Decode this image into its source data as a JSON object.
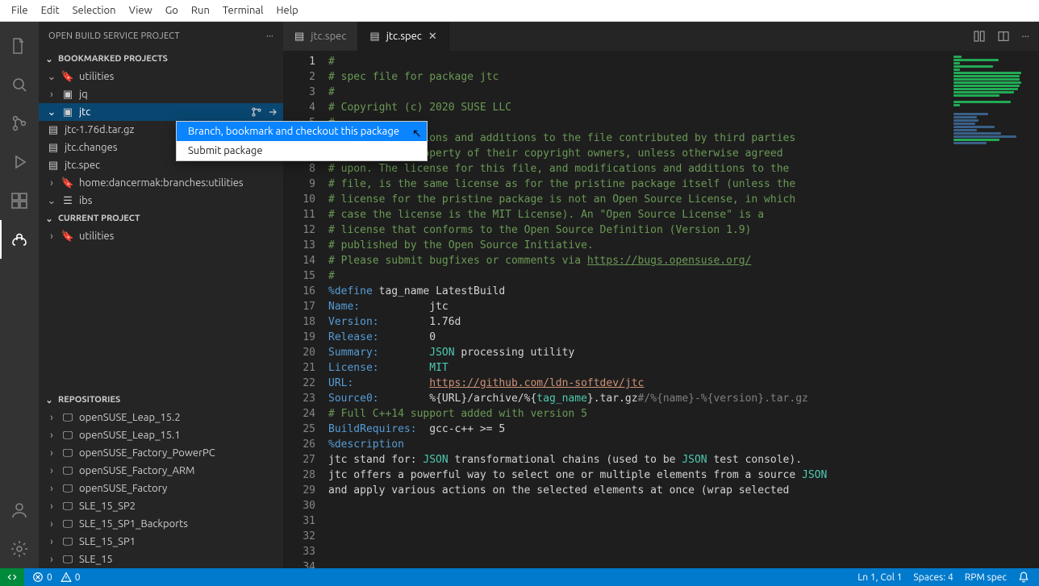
{
  "menubar": [
    "File",
    "Edit",
    "Selection",
    "View",
    "Go",
    "Run",
    "Terminal",
    "Help"
  ],
  "sidebar": {
    "title": "OPEN BUILD SERVICE PROJECT",
    "sections": {
      "bookmarked": "BOOKMARKED PROJECTS",
      "current": "CURRENT PROJECT",
      "repositories": "REPOSITORIES"
    },
    "tree1": {
      "utilities": "utilities",
      "jq": "jq",
      "jtc": "jtc",
      "jtc_files": [
        "jtc-1.76d.tar.gz",
        "jtc.changes",
        "jtc.spec"
      ],
      "home": "home:dancermak:branches:utilities",
      "ibs": "ibs"
    },
    "current_project_item": "utilities",
    "repositories": [
      "openSUSE_Leap_15.2",
      "openSUSE_Leap_15.1",
      "openSUSE_Factory_PowerPC",
      "openSUSE_Factory_ARM",
      "openSUSE_Factory",
      "SLE_15_SP2",
      "SLE_15_SP1_Backports",
      "SLE_15_SP1",
      "SLE_15"
    ]
  },
  "tabs": [
    {
      "label": "jtc.spec",
      "active": false
    },
    {
      "label": "jtc.spec",
      "active": true
    }
  ],
  "contextmenu": {
    "items": [
      "Branch, bookmark and checkout this package",
      "Submit package"
    ],
    "hovered": 0
  },
  "code": {
    "start_line": 1,
    "lines": [
      {
        "t": "c",
        "s": "#"
      },
      {
        "t": "c",
        "s": "# spec file for package jtc"
      },
      {
        "t": "c",
        "s": "#"
      },
      {
        "t": "c",
        "s": "# Copyright (c) 2020 SUSE LLC"
      },
      {
        "t": "c",
        "s": "#"
      },
      {
        "t": "c",
        "s": "# All modifications and additions to the file contributed by third parties"
      },
      {
        "t": "c",
        "s": "# remain the property of their copyright owners, unless otherwise agreed"
      },
      {
        "t": "c",
        "s": "# upon. The license for this file, and modifications and additions to the"
      },
      {
        "t": "c",
        "s": "# file, is the same license as for the pristine package itself (unless the"
      },
      {
        "t": "c",
        "s": "# license for the pristine package is not an Open Source License, in which"
      },
      {
        "t": "c",
        "s": "# case the license is the MIT License). An \"Open Source License\" is a"
      },
      {
        "t": "c",
        "s": "# license that conforms to the Open Source Definition (Version 1.9)"
      },
      {
        "t": "c",
        "s": "# published by the Open Source Initiative."
      },
      {
        "t": "e",
        "s": ""
      },
      {
        "t": "cx",
        "s": "# Please submit bugfixes or comments via ",
        "link": "https://bugs.opensuse.org/"
      },
      {
        "t": "c",
        "s": "#"
      },
      {
        "t": "e",
        "s": ""
      },
      {
        "t": "e",
        "s": ""
      },
      {
        "t": "def",
        "s": "%define tag_name LatestBuild"
      },
      {
        "t": "kv",
        "k": "Name:",
        "v": "jtc"
      },
      {
        "t": "kv",
        "k": "Version:",
        "v": "1.76d"
      },
      {
        "t": "kv",
        "k": "Release:",
        "v": "0"
      },
      {
        "t": "kvm",
        "k": "Summary:",
        "v1": "JSON",
        "v2": " processing utility"
      },
      {
        "t": "kv",
        "k": "License:",
        "v": "MIT",
        "vcolor": "macro"
      },
      {
        "t": "kvl",
        "k": "URL:",
        "v": "https://github.com/ldn-softdev/jtc"
      },
      {
        "t": "src",
        "k": "Source0:",
        "v1": "%{URL}/archive/%{",
        "v2": "tag_name",
        "v3": "}.tar.gz",
        "v4": "#/%{name}-%{version}.tar.gz"
      },
      {
        "t": "c",
        "s": "# Full C++14 support added with version 5"
      },
      {
        "t": "kv",
        "k": "BuildRequires:",
        "v": "gcc-c++ >= 5",
        "plain": true
      },
      {
        "t": "e",
        "s": ""
      },
      {
        "t": "sec",
        "s": "%description"
      },
      {
        "t": "desc",
        "s": "jtc stand for: ",
        "w": "JSON",
        "s2": " transformational chains (used to be ",
        "w2": "JSON",
        "s3": " test console)."
      },
      {
        "t": "e",
        "s": ""
      },
      {
        "t": "desc2",
        "s": "jtc offers a powerful way to select one or multiple elements from a source ",
        "w": "JSON"
      },
      {
        "t": "plain",
        "s": "and apply various actions on the selected elements at once (wrap selected"
      }
    ]
  },
  "statusbar": {
    "errors": "0",
    "warnings": "0",
    "ln": "Ln 1, Col 1",
    "spaces": "Spaces: 4",
    "lang": "RPM spec"
  }
}
